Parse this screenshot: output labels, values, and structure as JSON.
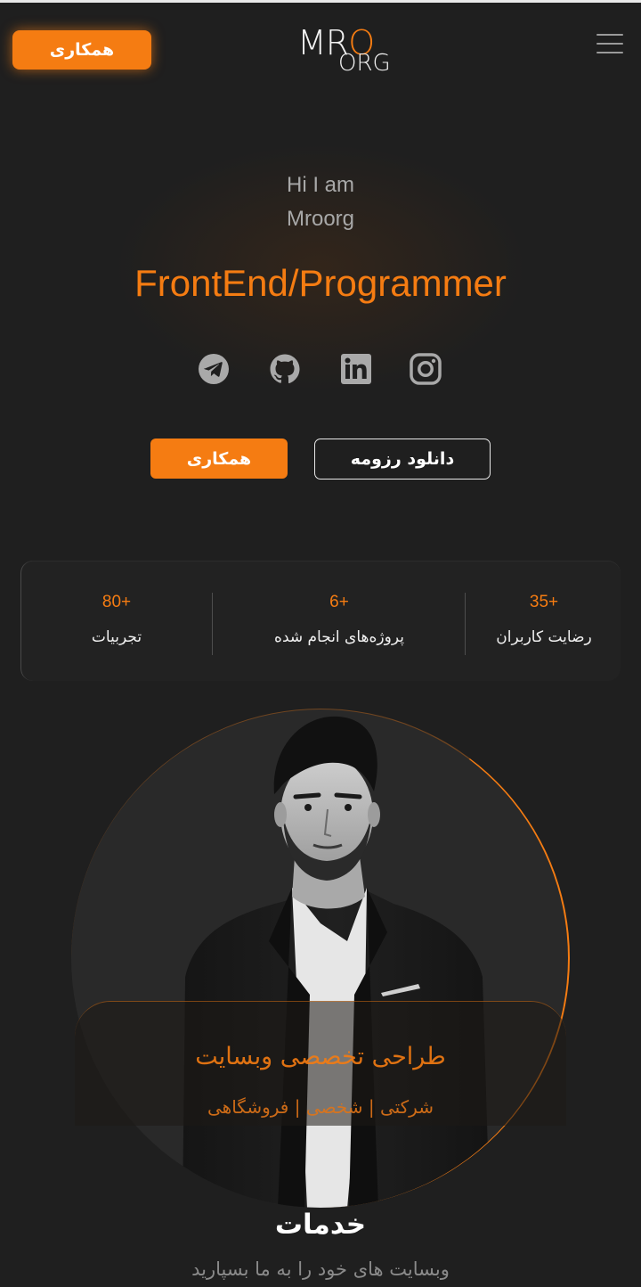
{
  "header": {
    "cta_label": "همکاری",
    "logo_line1": "MRO",
    "logo_line2": "ORG"
  },
  "hero": {
    "greeting_line1": "Hi I am",
    "greeting_line2": "Mroorg",
    "role": "FrontEnd/Programmer",
    "socials": [
      "telegram-icon",
      "github-icon",
      "linkedin-icon",
      "instagram-icon"
    ],
    "cooperate_label": "همکاری",
    "resume_label": "دانلود رزومه"
  },
  "stats": [
    {
      "value": "35+",
      "label": "رضایت کاربران"
    },
    {
      "value": "6+",
      "label": "پروژه‌های انجام شده"
    },
    {
      "value": "80+",
      "label": "تجربیات"
    }
  ],
  "feature_card": {
    "title": "طراحی تخصصی وبسایت",
    "subtitle": "شرکتی | شخصی | فروشگاهی"
  },
  "services": {
    "title": "خدمات",
    "subtitle": "وبسایت های خود را به ما بسپارید"
  },
  "colors": {
    "accent": "#f57c12",
    "background": "#1f1f1f"
  }
}
